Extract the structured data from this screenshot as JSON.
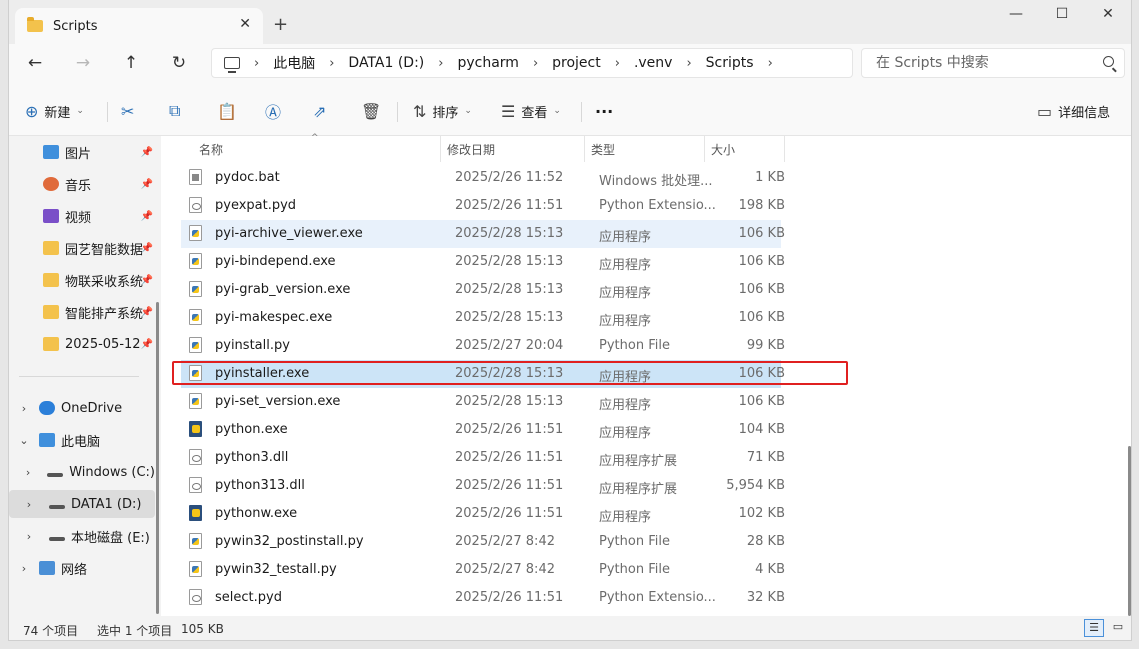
{
  "window": {
    "tab_title": "Scripts",
    "tab_close": "✕",
    "new_tab": "+",
    "minimize": "—",
    "maximize": "☐",
    "close": "✕"
  },
  "nav": {
    "back": "←",
    "forward": "→",
    "up": "↑",
    "refresh": "↻",
    "breadcrumb": [
      "此电脑",
      "DATA1 (D:)",
      "pycharm",
      "project",
      ".venv",
      "Scripts"
    ],
    "separator": "›",
    "search_placeholder": "在 Scripts 中搜索"
  },
  "toolbar": {
    "new_label": "新建",
    "sort_label": "排序",
    "view_label": "查看",
    "more_label": "···",
    "details_label": "详细信息"
  },
  "sidebar": {
    "items": [
      {
        "label": "图片",
        "pinned": true
      },
      {
        "label": "音乐",
        "pinned": true
      },
      {
        "label": "视频",
        "pinned": true
      },
      {
        "label": "园艺智能数据",
        "pinned": true
      },
      {
        "label": "物联采收系统",
        "pinned": true
      },
      {
        "label": "智能排产系统",
        "pinned": true
      },
      {
        "label": "2025-05-12",
        "pinned": true
      },
      {
        "label": "OneDrive",
        "pinned": false
      },
      {
        "label": "此电脑",
        "pinned": false
      },
      {
        "label": "Windows (C:)",
        "pinned": false
      },
      {
        "label": "DATA1 (D:)",
        "pinned": false
      },
      {
        "label": "本地磁盘 (E:)",
        "pinned": false
      },
      {
        "label": "网络",
        "pinned": false
      }
    ],
    "pin_glyph": "📌"
  },
  "columns": {
    "name": "名称",
    "modified": "修改日期",
    "type": "类型",
    "size": "大小"
  },
  "files": [
    {
      "name": "pydoc.bat",
      "modified": "2025/2/26 11:52",
      "type": "Windows 批处理...",
      "size": "1 KB",
      "icon": "bat"
    },
    {
      "name": "pyexpat.pyd",
      "modified": "2025/2/26 11:51",
      "type": "Python Extensio...",
      "size": "198 KB",
      "icon": "pyd"
    },
    {
      "name": "pyi-archive_viewer.exe",
      "modified": "2025/2/28 15:13",
      "type": "应用程序",
      "size": "106 KB",
      "icon": "exe"
    },
    {
      "name": "pyi-bindepend.exe",
      "modified": "2025/2/28 15:13",
      "type": "应用程序",
      "size": "106 KB",
      "icon": "exe"
    },
    {
      "name": "pyi-grab_version.exe",
      "modified": "2025/2/28 15:13",
      "type": "应用程序",
      "size": "106 KB",
      "icon": "exe"
    },
    {
      "name": "pyi-makespec.exe",
      "modified": "2025/2/28 15:13",
      "type": "应用程序",
      "size": "106 KB",
      "icon": "exe"
    },
    {
      "name": "pyinstall.py",
      "modified": "2025/2/27 20:04",
      "type": "Python File",
      "size": "99 KB",
      "icon": "py"
    },
    {
      "name": "pyinstaller.exe",
      "modified": "2025/2/28 15:13",
      "type": "应用程序",
      "size": "106 KB",
      "icon": "exe"
    },
    {
      "name": "pyi-set_version.exe",
      "modified": "2025/2/28 15:13",
      "type": "应用程序",
      "size": "106 KB",
      "icon": "exe"
    },
    {
      "name": "python.exe",
      "modified": "2025/2/26 11:51",
      "type": "应用程序",
      "size": "104 KB",
      "icon": "pyexe"
    },
    {
      "name": "python3.dll",
      "modified": "2025/2/26 11:51",
      "type": "应用程序扩展",
      "size": "71 KB",
      "icon": "dll"
    },
    {
      "name": "python313.dll",
      "modified": "2025/2/26 11:51",
      "type": "应用程序扩展",
      "size": "5,954 KB",
      "icon": "dll"
    },
    {
      "name": "pythonw.exe",
      "modified": "2025/2/26 11:51",
      "type": "应用程序",
      "size": "102 KB",
      "icon": "pyexe"
    },
    {
      "name": "pywin32_postinstall.py",
      "modified": "2025/2/27 8:42",
      "type": "Python File",
      "size": "28 KB",
      "icon": "py"
    },
    {
      "name": "pywin32_testall.py",
      "modified": "2025/2/27 8:42",
      "type": "Python File",
      "size": "4 KB",
      "icon": "py"
    },
    {
      "name": "select.pyd",
      "modified": "2025/2/26 11:51",
      "type": "Python Extensio...",
      "size": "32 KB",
      "icon": "pyd"
    }
  ],
  "hover_row": "pyi-archive_viewer.exe",
  "selected_row": "pyinstaller.exe",
  "status": {
    "item_count": "74 个项目",
    "selection": "选中 1 个项目",
    "selection_size": "105 KB"
  },
  "colors": {
    "selection": "#cce4f7",
    "hover": "#e8f1fb",
    "highlight_box": "#e02020",
    "accent": "#2a6fb5"
  }
}
